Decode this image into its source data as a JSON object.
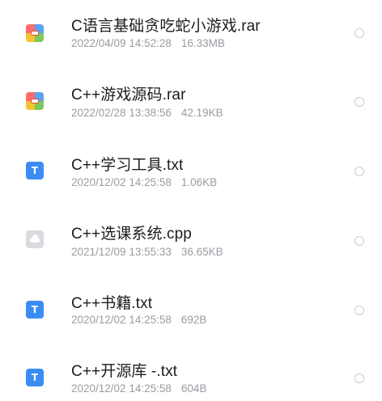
{
  "files": [
    {
      "name": "C语言基础贪吃蛇小游戏.rar",
      "date": "2022/04/09 14:52:28",
      "size": "16.33MB",
      "icon": "archive-icon",
      "selected": false
    },
    {
      "name": "C++游戏源码.rar",
      "date": "2022/02/28 13:38:56",
      "size": "42.19KB",
      "icon": "archive-icon",
      "selected": false
    },
    {
      "name": "C++学习工具.txt",
      "date": "2020/12/02 14:25:58",
      "size": "1.06KB",
      "icon": "text-file-icon",
      "icon_glyph": "T",
      "selected": false
    },
    {
      "name": "C++选课系统.cpp",
      "date": "2021/12/09 13:55:33",
      "size": "36.65KB",
      "icon": "cloud-file-icon",
      "selected": false
    },
    {
      "name": "C++书籍.txt",
      "date": "2020/12/02 14:25:58",
      "size": "692B",
      "icon": "text-file-icon",
      "icon_glyph": "T",
      "selected": false
    },
    {
      "name": "C++开源库 -.txt",
      "date": "2020/12/02 14:25:58",
      "size": "604B",
      "icon": "text-file-icon",
      "icon_glyph": "T",
      "selected": false
    }
  ],
  "colors": {
    "name_text": "#1c1c1e",
    "meta_text": "#9a9ca3",
    "text_icon_blue": "#3b8cf3",
    "cloud_icon_gray": "#d9dbe0",
    "radio_border": "#c9cbd1"
  }
}
